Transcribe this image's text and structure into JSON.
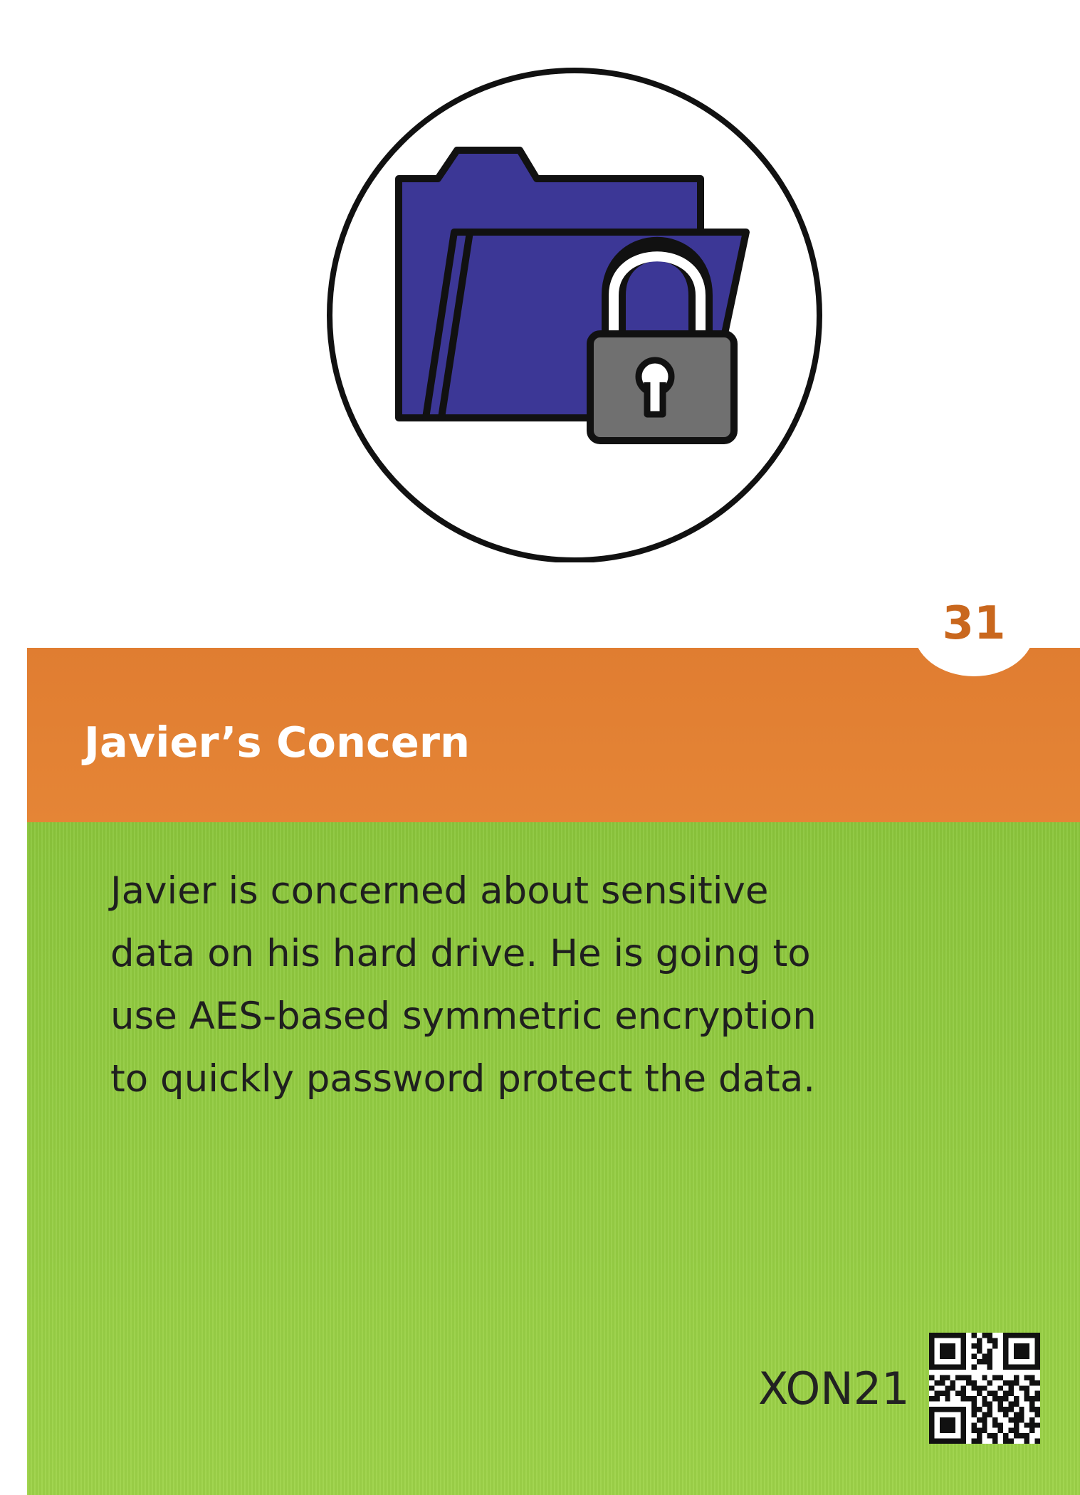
{
  "card": {
    "number": "31",
    "title": "Javier’s Concern",
    "body_lines": [
      "Javier is concerned about sensitive",
      "data on his hard drive. He is going to",
      "use AES-based symmetric encryption",
      "to quickly password protect the data."
    ],
    "code": "XON21"
  },
  "icons": {
    "main_icon": "locked-folder-icon",
    "qr_code": "qr-code-icon"
  },
  "colors": {
    "title_band": "#e07d31",
    "body_panel": "#95cd43",
    "card_number": "#c9671d",
    "folder": "#3c3796",
    "lock": "#707070"
  }
}
